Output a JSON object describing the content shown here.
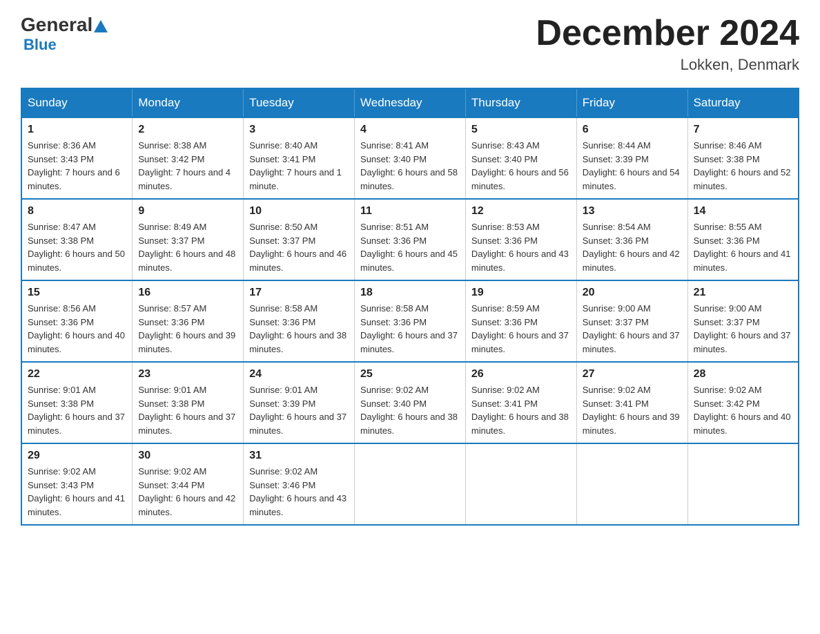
{
  "header": {
    "logo": {
      "general": "General",
      "blue": "Blue"
    },
    "month_title": "December 2024",
    "location": "Lokken, Denmark"
  },
  "calendar": {
    "days_of_week": [
      "Sunday",
      "Monday",
      "Tuesday",
      "Wednesday",
      "Thursday",
      "Friday",
      "Saturday"
    ],
    "weeks": [
      [
        {
          "day": "1",
          "sunrise": "8:36 AM",
          "sunset": "3:43 PM",
          "daylight": "7 hours and 6 minutes."
        },
        {
          "day": "2",
          "sunrise": "8:38 AM",
          "sunset": "3:42 PM",
          "daylight": "7 hours and 4 minutes."
        },
        {
          "day": "3",
          "sunrise": "8:40 AM",
          "sunset": "3:41 PM",
          "daylight": "7 hours and 1 minute."
        },
        {
          "day": "4",
          "sunrise": "8:41 AM",
          "sunset": "3:40 PM",
          "daylight": "6 hours and 58 minutes."
        },
        {
          "day": "5",
          "sunrise": "8:43 AM",
          "sunset": "3:40 PM",
          "daylight": "6 hours and 56 minutes."
        },
        {
          "day": "6",
          "sunrise": "8:44 AM",
          "sunset": "3:39 PM",
          "daylight": "6 hours and 54 minutes."
        },
        {
          "day": "7",
          "sunrise": "8:46 AM",
          "sunset": "3:38 PM",
          "daylight": "6 hours and 52 minutes."
        }
      ],
      [
        {
          "day": "8",
          "sunrise": "8:47 AM",
          "sunset": "3:38 PM",
          "daylight": "6 hours and 50 minutes."
        },
        {
          "day": "9",
          "sunrise": "8:49 AM",
          "sunset": "3:37 PM",
          "daylight": "6 hours and 48 minutes."
        },
        {
          "day": "10",
          "sunrise": "8:50 AM",
          "sunset": "3:37 PM",
          "daylight": "6 hours and 46 minutes."
        },
        {
          "day": "11",
          "sunrise": "8:51 AM",
          "sunset": "3:36 PM",
          "daylight": "6 hours and 45 minutes."
        },
        {
          "day": "12",
          "sunrise": "8:53 AM",
          "sunset": "3:36 PM",
          "daylight": "6 hours and 43 minutes."
        },
        {
          "day": "13",
          "sunrise": "8:54 AM",
          "sunset": "3:36 PM",
          "daylight": "6 hours and 42 minutes."
        },
        {
          "day": "14",
          "sunrise": "8:55 AM",
          "sunset": "3:36 PM",
          "daylight": "6 hours and 41 minutes."
        }
      ],
      [
        {
          "day": "15",
          "sunrise": "8:56 AM",
          "sunset": "3:36 PM",
          "daylight": "6 hours and 40 minutes."
        },
        {
          "day": "16",
          "sunrise": "8:57 AM",
          "sunset": "3:36 PM",
          "daylight": "6 hours and 39 minutes."
        },
        {
          "day": "17",
          "sunrise": "8:58 AM",
          "sunset": "3:36 PM",
          "daylight": "6 hours and 38 minutes."
        },
        {
          "day": "18",
          "sunrise": "8:58 AM",
          "sunset": "3:36 PM",
          "daylight": "6 hours and 37 minutes."
        },
        {
          "day": "19",
          "sunrise": "8:59 AM",
          "sunset": "3:36 PM",
          "daylight": "6 hours and 37 minutes."
        },
        {
          "day": "20",
          "sunrise": "9:00 AM",
          "sunset": "3:37 PM",
          "daylight": "6 hours and 37 minutes."
        },
        {
          "day": "21",
          "sunrise": "9:00 AM",
          "sunset": "3:37 PM",
          "daylight": "6 hours and 37 minutes."
        }
      ],
      [
        {
          "day": "22",
          "sunrise": "9:01 AM",
          "sunset": "3:38 PM",
          "daylight": "6 hours and 37 minutes."
        },
        {
          "day": "23",
          "sunrise": "9:01 AM",
          "sunset": "3:38 PM",
          "daylight": "6 hours and 37 minutes."
        },
        {
          "day": "24",
          "sunrise": "9:01 AM",
          "sunset": "3:39 PM",
          "daylight": "6 hours and 37 minutes."
        },
        {
          "day": "25",
          "sunrise": "9:02 AM",
          "sunset": "3:40 PM",
          "daylight": "6 hours and 38 minutes."
        },
        {
          "day": "26",
          "sunrise": "9:02 AM",
          "sunset": "3:41 PM",
          "daylight": "6 hours and 38 minutes."
        },
        {
          "day": "27",
          "sunrise": "9:02 AM",
          "sunset": "3:41 PM",
          "daylight": "6 hours and 39 minutes."
        },
        {
          "day": "28",
          "sunrise": "9:02 AM",
          "sunset": "3:42 PM",
          "daylight": "6 hours and 40 minutes."
        }
      ],
      [
        {
          "day": "29",
          "sunrise": "9:02 AM",
          "sunset": "3:43 PM",
          "daylight": "6 hours and 41 minutes."
        },
        {
          "day": "30",
          "sunrise": "9:02 AM",
          "sunset": "3:44 PM",
          "daylight": "6 hours and 42 minutes."
        },
        {
          "day": "31",
          "sunrise": "9:02 AM",
          "sunset": "3:46 PM",
          "daylight": "6 hours and 43 minutes."
        },
        null,
        null,
        null,
        null
      ]
    ]
  }
}
